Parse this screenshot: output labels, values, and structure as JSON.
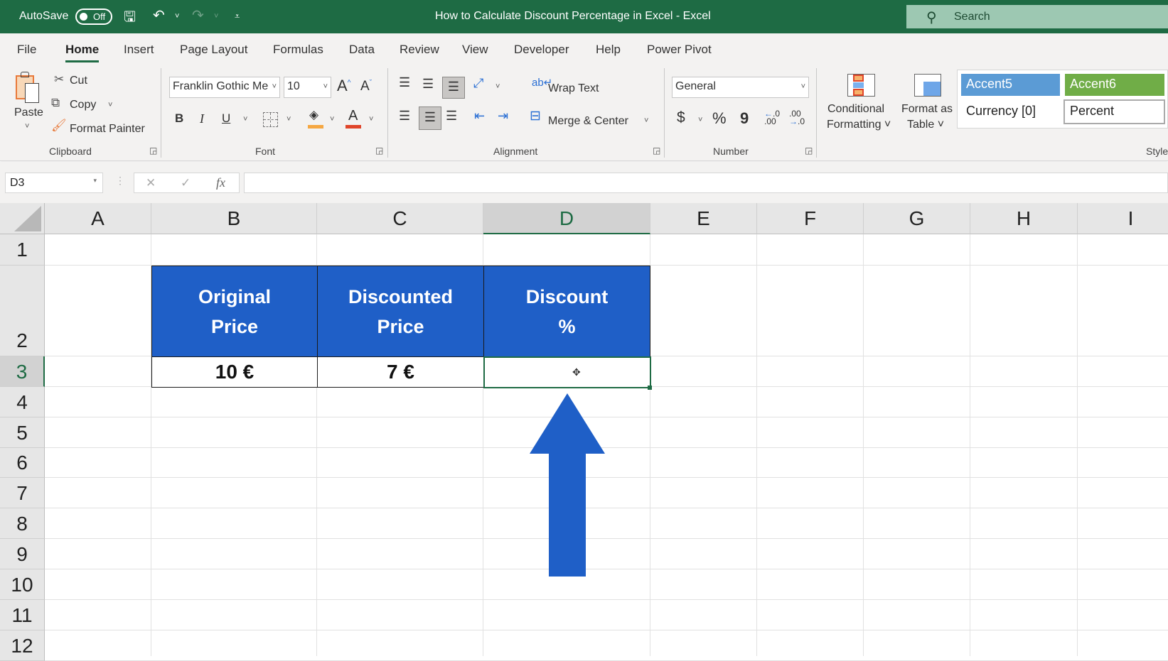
{
  "titlebar": {
    "autosave_label": "AutoSave",
    "autosave_state": "Off",
    "title": "How to Calculate Discount Percentage in Excel  -  Excel",
    "search_placeholder": "Search"
  },
  "tabs": [
    "File",
    "Home",
    "Insert",
    "Page Layout",
    "Formulas",
    "Data",
    "Review",
    "View",
    "Developer",
    "Help",
    "Power Pivot"
  ],
  "active_tab": "Home",
  "ribbon": {
    "clipboard": {
      "paste": "Paste",
      "cut": "Cut",
      "copy": "Copy",
      "format_painter": "Format Painter",
      "label": "Clipboard"
    },
    "font": {
      "name": "Franklin Gothic Me",
      "size": "10",
      "bold": "B",
      "italic": "I",
      "underline": "U",
      "font_color_letter": "A",
      "label": "Font",
      "fill_color": "#f5a742",
      "font_color": "#e0452a"
    },
    "alignment": {
      "wrap_text": "Wrap Text",
      "merge_center": "Merge & Center",
      "label": "Alignment"
    },
    "number": {
      "format": "General",
      "currency": "$",
      "percent": "%",
      "comma": "9",
      "label": "Number"
    },
    "styles": {
      "conditional_formatting": [
        "Conditional",
        "Formatting ˅"
      ],
      "format_as_table": [
        "Format as",
        "Table ˅"
      ],
      "cells": [
        {
          "name": "Accent5",
          "bg": "#5b9bd5",
          "fg": "#ffffff"
        },
        {
          "name": "Accent6",
          "bg": "#70ad47",
          "fg": "#ffffff"
        },
        {
          "name": "Currency [0]",
          "bg": "#ffffff",
          "fg": "#222222"
        },
        {
          "name": "Percent",
          "bg": "#ffffff",
          "fg": "#222222"
        }
      ],
      "label": "Style"
    }
  },
  "formula_bar": {
    "name_box": "D3",
    "cancel": "✕",
    "enter": "✓",
    "fx": "fx",
    "value": ""
  },
  "sheet": {
    "columns": [
      "A",
      "B",
      "C",
      "D",
      "E",
      "F",
      "G",
      "H",
      "I"
    ],
    "rows": [
      "1",
      "2",
      "3",
      "4",
      "5",
      "6",
      "7",
      "8",
      "9",
      "10",
      "11",
      "12"
    ],
    "selected_cell": "D3",
    "header_fill": "#1f5fc7",
    "table_headers": [
      "Original\nPrice",
      "Discounted\nPrice",
      "Discount\n%"
    ],
    "table_values": [
      "10 €",
      "7 €",
      ""
    ],
    "arrow_color": "#1f5fc7"
  }
}
